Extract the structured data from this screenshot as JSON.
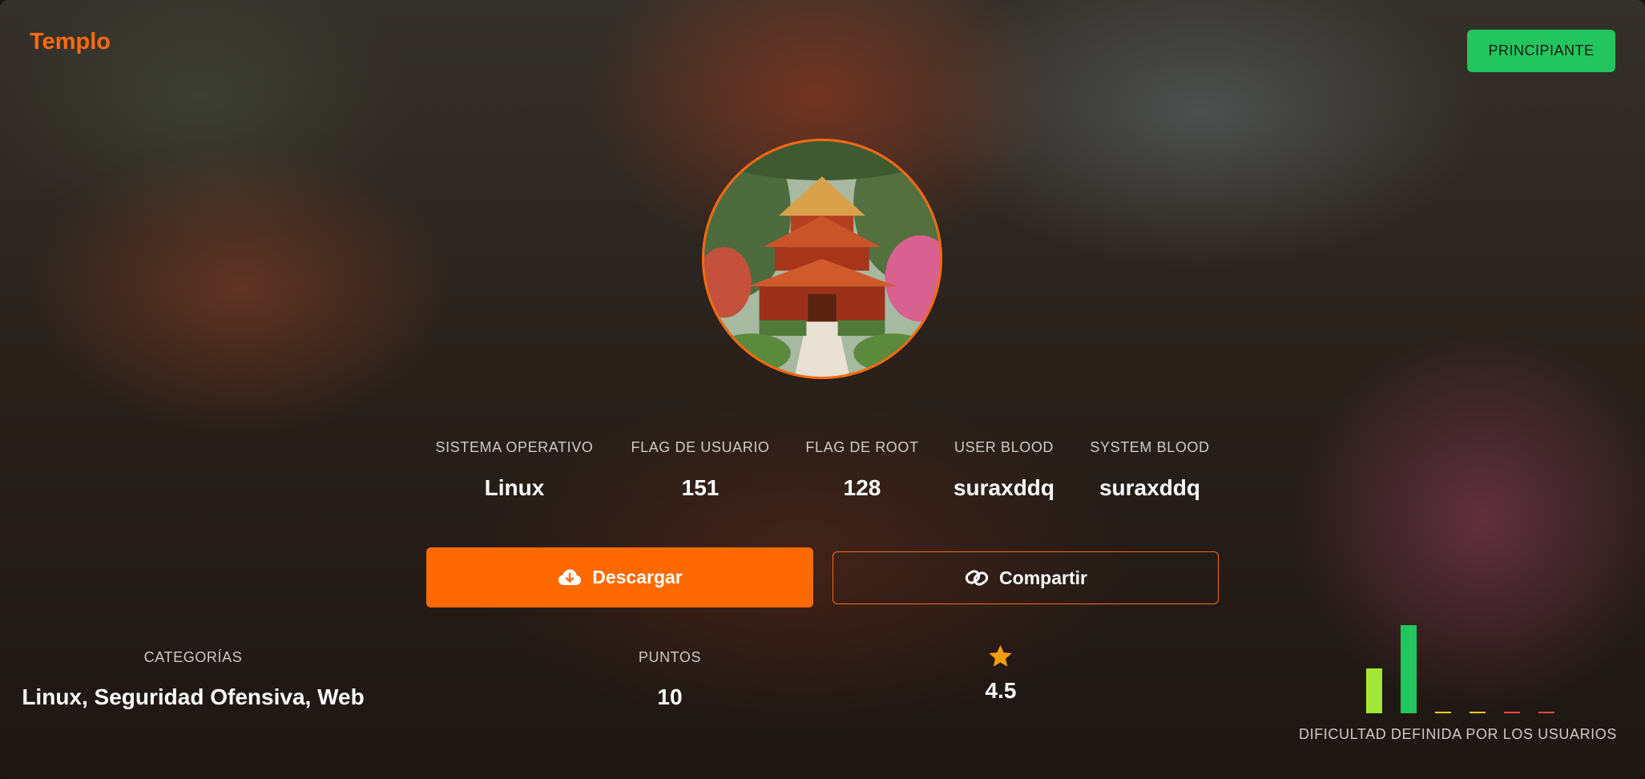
{
  "app": {
    "title": "Templo"
  },
  "badge": {
    "label": "PRINCIPIANTE",
    "color": "#22c55e"
  },
  "accent_color": "#ff6a0c",
  "avatar": {
    "icon": "temple-image"
  },
  "stats": [
    {
      "label": "SISTEMA OPERATIVO",
      "value": "Linux"
    },
    {
      "label": "FLAG DE USUARIO",
      "value": "151"
    },
    {
      "label": "FLAG DE ROOT",
      "value": "128"
    },
    {
      "label": "USER BLOOD",
      "value": "suraxddq"
    },
    {
      "label": "SYSTEM BLOOD",
      "value": "suraxddq"
    }
  ],
  "actions": {
    "download": {
      "label": "Descargar",
      "icon": "cloud-download-icon"
    },
    "share": {
      "label": "Compartir",
      "icon": "link-icon"
    }
  },
  "info": {
    "categories": {
      "label": "CATEGORÍAS",
      "value": "Linux, Seguridad Ofensiva, Web"
    },
    "points": {
      "label": "PUNTOS",
      "value": "10"
    },
    "rating": {
      "icon": "star-icon",
      "value": "4.5"
    }
  },
  "difficulty": {
    "label": "DIFICULTAD DEFINIDA POR LOS USUARIOS",
    "chart_data": {
      "type": "bar",
      "values": [
        28,
        55,
        1,
        1,
        1,
        1
      ],
      "colors": [
        "#a3e635",
        "#22c55e",
        "#facc15",
        "#facc15",
        "#ef4444",
        "#ef4444"
      ]
    }
  }
}
